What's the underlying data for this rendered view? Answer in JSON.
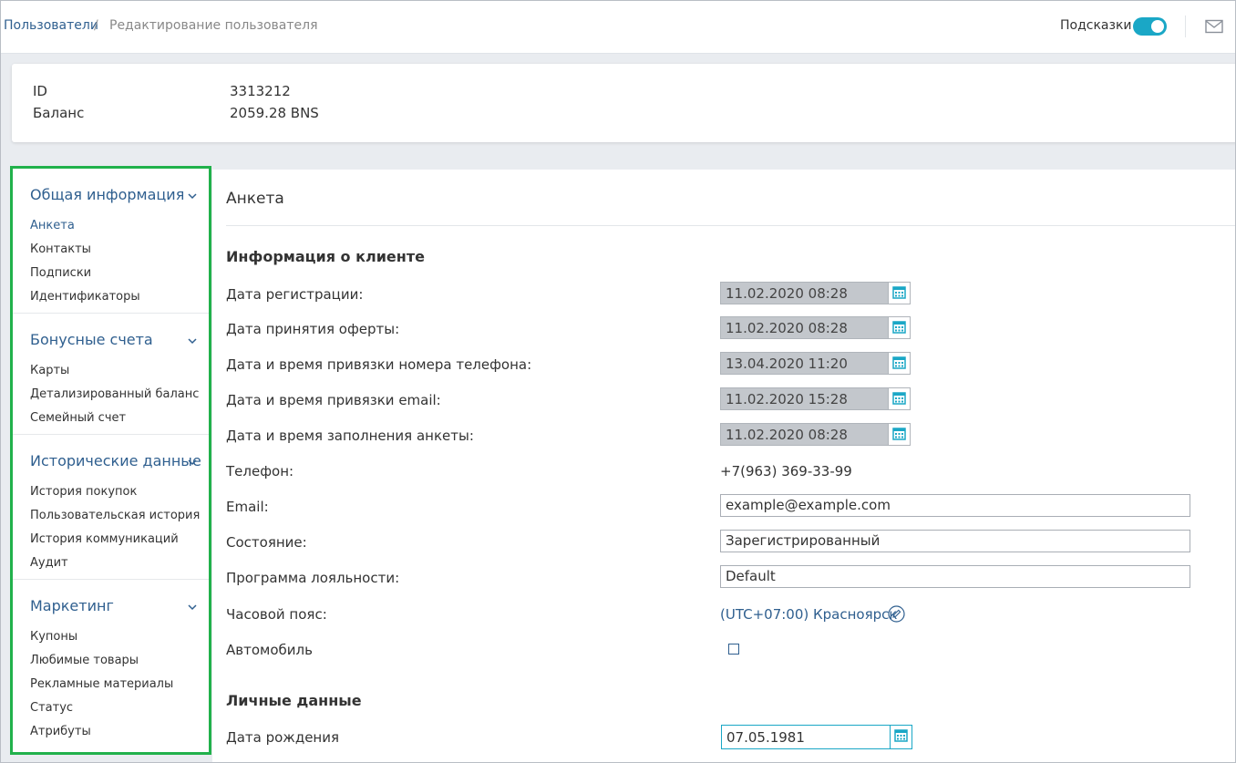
{
  "breadcrumb": {
    "root": "Пользователи",
    "separator": "/",
    "current": "Редактирование пользователя"
  },
  "header": {
    "hints_label": "Подсказки",
    "hints_enabled": true,
    "mail_icon": "mail-icon"
  },
  "info": {
    "id_label": "ID",
    "id_value": "3313212",
    "balance_label": "Баланс",
    "balance_value": "2059.28 BNS"
  },
  "sidebar": {
    "groups": [
      {
        "title": "Общая информация",
        "items": [
          "Анкета",
          "Контакты",
          "Подписки",
          "Идентификаторы"
        ]
      },
      {
        "title": "Бонусные счета",
        "items": [
          "Карты",
          "Детализированный баланс",
          "Семейный счет"
        ]
      },
      {
        "title": "Исторические данные",
        "items": [
          "История покупок",
          "Пользовательская история",
          "История коммуникаций",
          "Аудит"
        ]
      },
      {
        "title": "Маркетинг",
        "items": [
          "Купоны",
          "Любимые товары",
          "Рекламные материалы",
          "Статус",
          "Атрибуты"
        ]
      }
    ],
    "active_item": "Анкета"
  },
  "main": {
    "title": "Анкета",
    "client_section": "Информация о клиенте",
    "fields": {
      "reg_date_label": "Дата регистрации:",
      "reg_date_value": "11.02.2020 08:28",
      "offer_date_label": "Дата принятия оферты:",
      "offer_date_value": "11.02.2020 08:28",
      "phone_bind_label": "Дата и время привязки номера телефона:",
      "phone_bind_value": "13.04.2020 11:20",
      "email_bind_label": "Дата и время привязки email:",
      "email_bind_value": "11.02.2020 15:28",
      "form_fill_label": "Дата и время заполнения анкеты:",
      "form_fill_value": "11.02.2020 08:28",
      "phone_label": "Телефон:",
      "phone_value": "+7(963) 369-33-99",
      "email_label": "Email:",
      "email_value": "example@example.com",
      "state_label": "Состояние:",
      "state_value": "Зарегистрированный",
      "loyalty_label": "Программа лояльности:",
      "loyalty_value": "Default",
      "timezone_label": "Часовой пояс:",
      "timezone_value": "(UTC+07:00) Красноярск",
      "car_label": "Автомобиль",
      "car_checked": false
    },
    "personal_section": "Личные данные",
    "birth_label": "Дата рождения",
    "birth_value": "07.05.1981"
  },
  "colors": {
    "accent": "#1aa7c6",
    "link": "#2f5f8f",
    "sidebar_highlight": "#21b14b",
    "readonly_field": "#c3c7cc"
  }
}
